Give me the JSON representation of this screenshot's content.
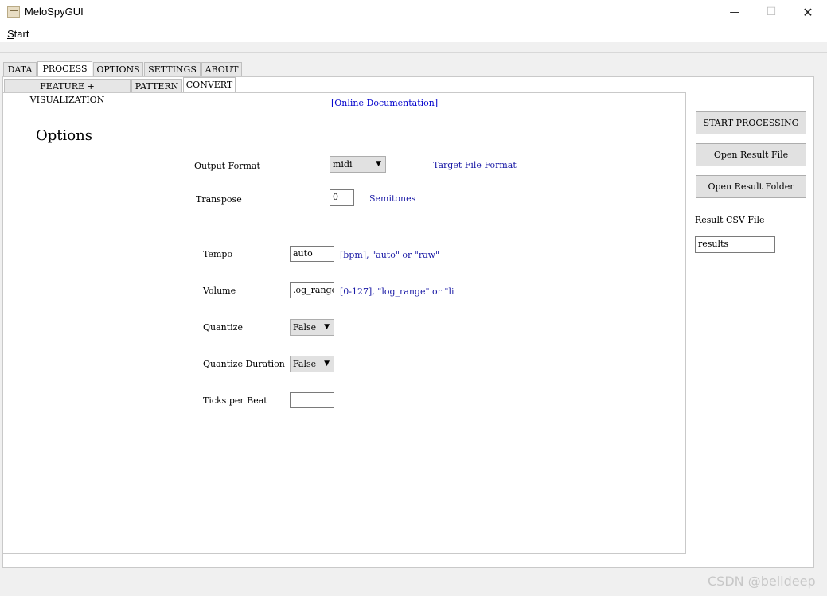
{
  "window": {
    "title": "MeloSpyGUI",
    "minimize": "—",
    "maximize": "☐",
    "close": "✕",
    "icon": "melospy-app-icon"
  },
  "menu": {
    "start_prefix": "S",
    "start_rest": "tart"
  },
  "tabs": {
    "main": [
      "DATA",
      "PROCESS",
      "OPTIONS",
      "SETTINGS",
      "ABOUT"
    ],
    "main_active": "PROCESS",
    "sub": [
      "FEATURE + VISUALIZATION",
      "PATTERN",
      "CONVERT"
    ],
    "sub_active": "CONVERT"
  },
  "content": {
    "doc_link": "[Online Documentation]",
    "section_title": "Options",
    "output_format": {
      "label": "Output Format",
      "value": "midi",
      "hint": "Target File Format"
    },
    "transpose": {
      "label": "Transpose",
      "value": "0",
      "hint": "Semitones"
    },
    "tempo": {
      "label": "Tempo",
      "value": "auto",
      "hint": "[bpm], \"auto\" or \"raw\""
    },
    "volume": {
      "label": "Volume",
      "value": ".og_range",
      "hint": "[0-127], \"log_range\" or \"li"
    },
    "quantize": {
      "label": "Quantize",
      "value": "False"
    },
    "quantize_duration": {
      "label": "Quantize Duration",
      "value": "False"
    },
    "ticks_per_beat": {
      "label": "Ticks per Beat",
      "value": ""
    }
  },
  "sidebar": {
    "start_processing": "START PROCESSING",
    "open_result_file": "Open Result File",
    "open_result_folder": "Open Result Folder",
    "result_csv_label": "Result CSV File",
    "result_csv_value": "results"
  },
  "watermark": "CSDN @belldeep",
  "colors": {
    "hint": "#1a1aa6",
    "link": "#0000cc"
  }
}
